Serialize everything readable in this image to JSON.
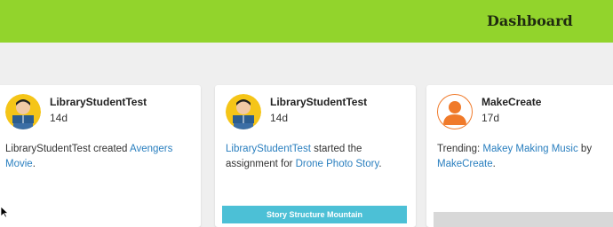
{
  "header": {
    "title": "Dashboard",
    "bg_color": "#92d42c"
  },
  "cards": [
    {
      "author": "LibraryStudentTest",
      "age": "14d",
      "avatar": "reading-student-avatar",
      "text_pre": "LibraryStudentTest created ",
      "link1": "Avengers Movie",
      "text_post": "."
    },
    {
      "author": "LibraryStudentTest",
      "age": "14d",
      "avatar": "reading-student-avatar",
      "link0": "LibraryStudentTest",
      "text_mid": " started the assignment for ",
      "link1": "Drone Photo Story",
      "text_post": ".",
      "banner": "Story Structure Mountain"
    },
    {
      "author": "MakeCreate",
      "age": "17d",
      "avatar": "person-icon-avatar",
      "text_pre": "Trending: ",
      "link1": "Makey Making Music",
      "text_mid": " by ",
      "link2": "MakeCreate",
      "text_post": "."
    }
  ],
  "colors": {
    "link": "#2a7fbf",
    "accent": "#92d42c",
    "banner": "#4cc0d6"
  }
}
